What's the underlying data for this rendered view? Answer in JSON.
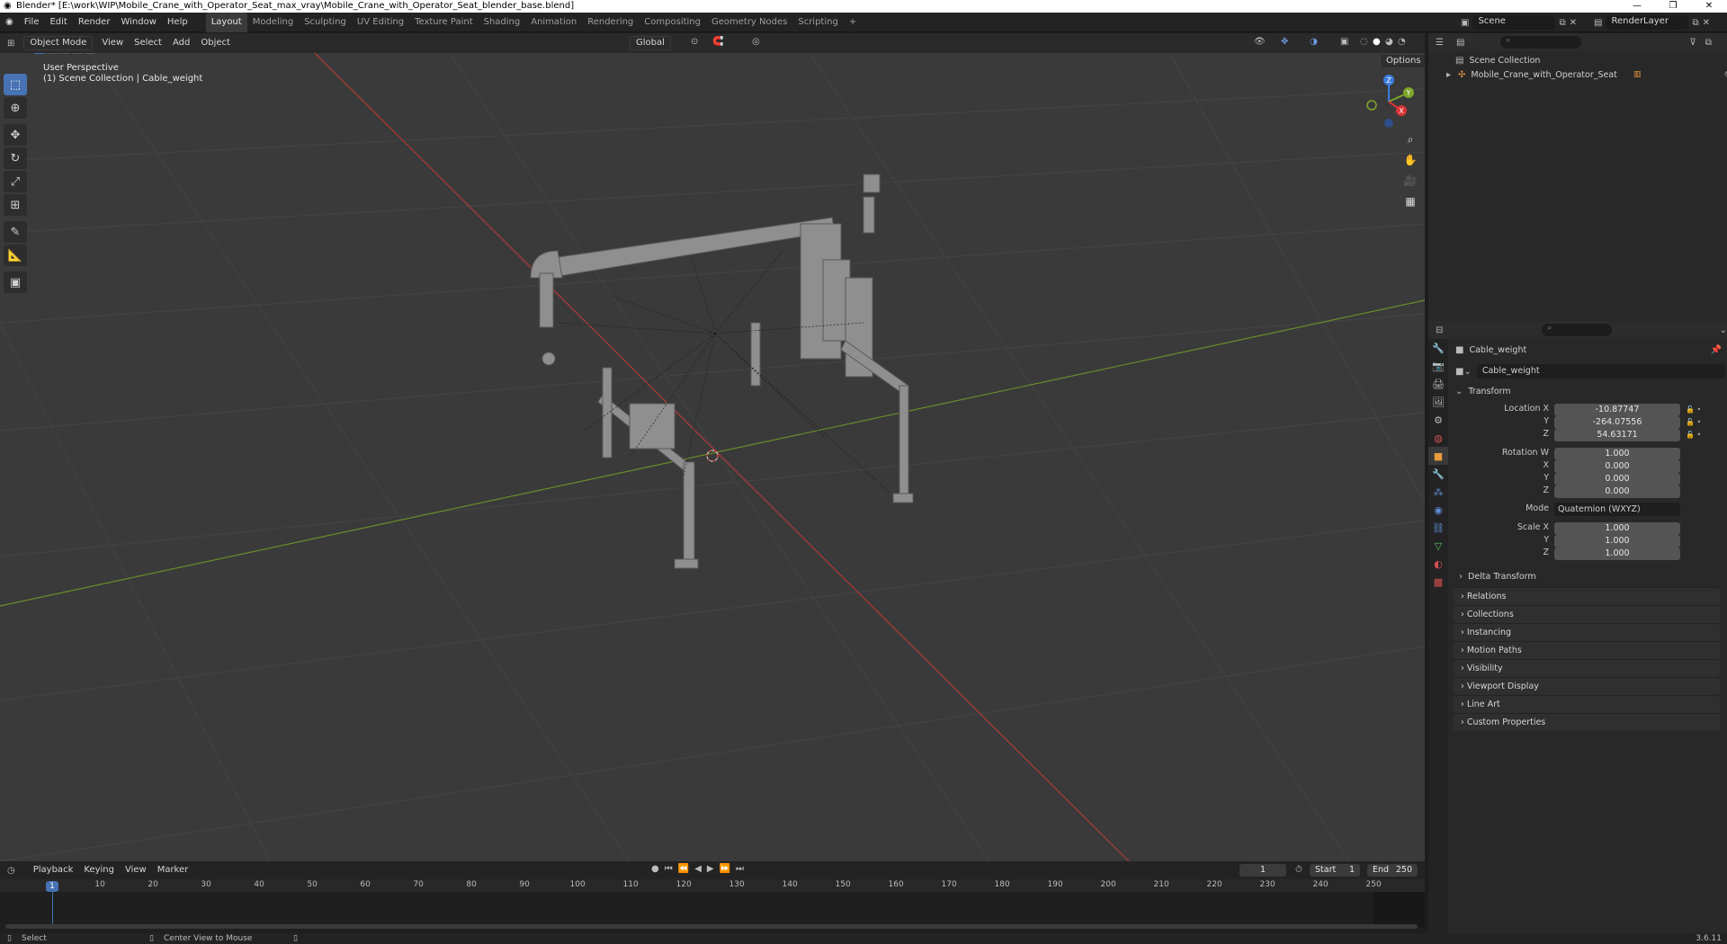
{
  "window": {
    "title": "Blender* [E:\\work\\WIP\\Mobile_Crane_with_Operator_Seat_max_vray\\Mobile_Crane_with_Operator_Seat_blender_base.blend]",
    "min": "—",
    "max": "❐",
    "close": "✕"
  },
  "menu": [
    "File",
    "Edit",
    "Render",
    "Window",
    "Help"
  ],
  "workspaces": [
    "Layout",
    "Modeling",
    "Sculpting",
    "UV Editing",
    "Texture Paint",
    "Shading",
    "Animation",
    "Rendering",
    "Compositing",
    "Geometry Nodes",
    "Scripting",
    "+"
  ],
  "scene": {
    "name": "Scene",
    "render_layer": "RenderLayer"
  },
  "viewport_header": {
    "mode": "Object Mode",
    "menus": [
      "View",
      "Select",
      "Add",
      "Object"
    ],
    "transform_orientation": "Global",
    "options": "Options"
  },
  "overlay": {
    "perspective": "User Perspective",
    "collection": "(1) Scene Collection | Cable_weight"
  },
  "gizmo": {
    "x": "X",
    "y": "Y",
    "z": "Z"
  },
  "outliner": {
    "root": "Scene Collection",
    "item": "Mobile_Crane_with_Operator_Seat"
  },
  "properties": {
    "object_name": "Cable_weight",
    "data_name": "Cable_weight",
    "transform_label": "Transform",
    "location": {
      "label": "Location X",
      "x": "-10.87747",
      "y_label": "Y",
      "y": "-264.07556",
      "z_label": "Z",
      "z": "54.63171"
    },
    "rotation": {
      "label": "Rotation W",
      "w": "1.000",
      "x_label": "X",
      "x": "0.000",
      "y_label": "Y",
      "y": "0.000",
      "z_label": "Z",
      "z": "0.000"
    },
    "mode": {
      "label": "Mode",
      "value": "Quaternion (WXYZ)"
    },
    "scale": {
      "label": "Scale X",
      "x": "1.000",
      "y_label": "Y",
      "y": "1.000",
      "z_label": "Z",
      "z": "1.000"
    },
    "delta": "Delta Transform",
    "panels": [
      "Relations",
      "Collections",
      "Instancing",
      "Motion Paths",
      "Visibility",
      "Viewport Display",
      "Line Art",
      "Custom Properties"
    ]
  },
  "timeline": {
    "menus": [
      "Playback",
      "Keying",
      "View",
      "Marker"
    ],
    "current_frame": "1",
    "start_label": "Start",
    "start": "1",
    "end_label": "End",
    "end": "250",
    "ticks": [
      "10",
      "20",
      "30",
      "40",
      "50",
      "60",
      "70",
      "80",
      "90",
      "100",
      "110",
      "120",
      "130",
      "140",
      "150",
      "160",
      "170",
      "180",
      "190",
      "200",
      "210",
      "220",
      "230",
      "240",
      "250"
    ],
    "playhead": "1"
  },
  "statusbar": {
    "select": "Select",
    "center": "Center View to Mouse",
    "version": "3.6.11"
  }
}
